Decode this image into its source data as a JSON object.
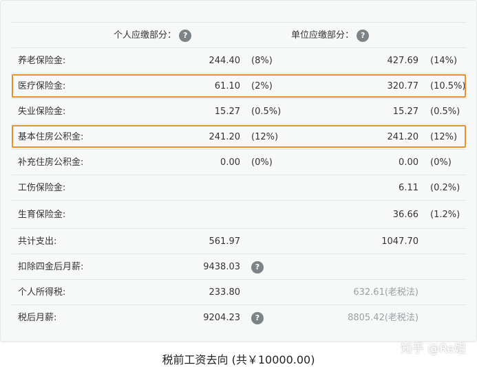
{
  "header": {
    "personal_label": "个人应缴部分：",
    "unit_label": "单位应缴部分：",
    "help_glyph": "?"
  },
  "rows": [
    {
      "label": "养老保险金:",
      "p_val": "244.40",
      "p_pct": "(8%)",
      "u_val": "427.69",
      "u_pct": "(14%)"
    },
    {
      "label": "医疗保险金:",
      "p_val": "61.10",
      "p_pct": "(2%)",
      "u_val": "320.77",
      "u_pct": "(10.5%)"
    },
    {
      "label": "失业保险金:",
      "p_val": "15.27",
      "p_pct": "(0.5%)",
      "u_val": "15.27",
      "u_pct": "(0.5%)"
    },
    {
      "label": "基本住房公积金:",
      "p_val": "241.20",
      "p_pct": "(12%)",
      "u_val": "241.20",
      "u_pct": "(12%)"
    },
    {
      "label": "补充住房公积金:",
      "p_val": "0.00",
      "p_pct": "(0%)",
      "u_val": "0.00",
      "u_pct": "(0%)"
    },
    {
      "label": "工伤保险金:",
      "p_val": "",
      "p_pct": "",
      "u_val": "6.11",
      "u_pct": "(0.2%)"
    },
    {
      "label": "生育保险金:",
      "p_val": "",
      "p_pct": "",
      "u_val": "36.66",
      "u_pct": "(1.2%)"
    }
  ],
  "summary": [
    {
      "label": "共计支出:",
      "p_val": "561.97",
      "u_val": "1047.70"
    },
    {
      "label": "扣除四金后月薪:",
      "p_val": "9438.03"
    },
    {
      "label": "个人所得税:",
      "p_val": "233.80",
      "u_val": "632.61(老税法)"
    },
    {
      "label": "税后月薪:",
      "p_val": "9204.23",
      "u_val": "8805.42(老税法)"
    }
  ],
  "caption": "税前工资去向 (共￥10000.00)",
  "watermark": "知乎 @Re姐",
  "colors": {
    "highlight": "#e8912d",
    "help_badge": "#7d8487"
  }
}
